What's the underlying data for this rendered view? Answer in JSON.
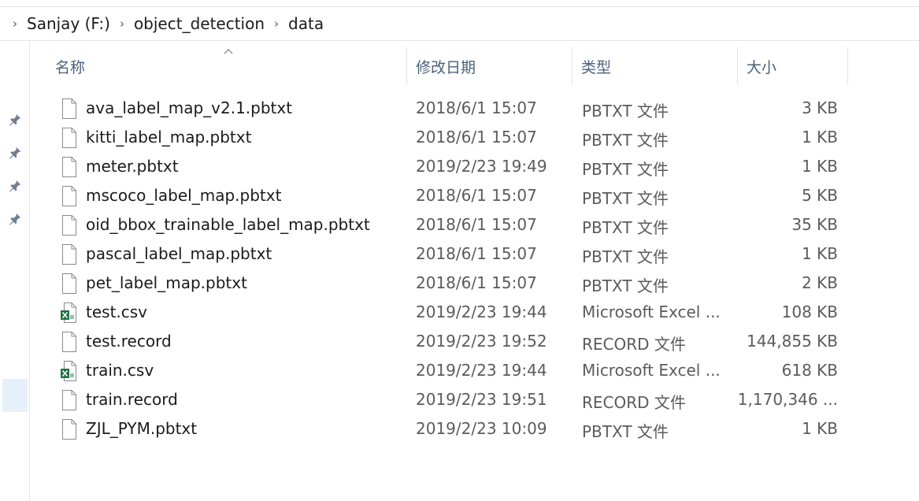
{
  "breadcrumb": {
    "items": [
      "Sanjay (F:)",
      "object_detection",
      "data"
    ]
  },
  "columns": {
    "name": "名称",
    "date": "修改日期",
    "type": "类型",
    "size": "大小"
  },
  "files": [
    {
      "name": "ava_label_map_v2.1.pbtxt",
      "date": "2018/6/1 15:07",
      "type": "PBTXT 文件",
      "size": "3 KB",
      "icon": "file-icon"
    },
    {
      "name": "kitti_label_map.pbtxt",
      "date": "2018/6/1 15:07",
      "type": "PBTXT 文件",
      "size": "1 KB",
      "icon": "file-icon"
    },
    {
      "name": "meter.pbtxt",
      "date": "2019/2/23 19:49",
      "type": "PBTXT 文件",
      "size": "1 KB",
      "icon": "file-icon"
    },
    {
      "name": "mscoco_label_map.pbtxt",
      "date": "2018/6/1 15:07",
      "type": "PBTXT 文件",
      "size": "5 KB",
      "icon": "file-icon"
    },
    {
      "name": "oid_bbox_trainable_label_map.pbtxt",
      "date": "2018/6/1 15:07",
      "type": "PBTXT 文件",
      "size": "35 KB",
      "icon": "file-icon"
    },
    {
      "name": "pascal_label_map.pbtxt",
      "date": "2018/6/1 15:07",
      "type": "PBTXT 文件",
      "size": "1 KB",
      "icon": "file-icon"
    },
    {
      "name": "pet_label_map.pbtxt",
      "date": "2018/6/1 15:07",
      "type": "PBTXT 文件",
      "size": "2 KB",
      "icon": "file-icon"
    },
    {
      "name": "test.csv",
      "date": "2019/2/23 19:44",
      "type": "Microsoft Excel ...",
      "size": "108 KB",
      "icon": "excel-file-icon"
    },
    {
      "name": "test.record",
      "date": "2019/2/23 19:52",
      "type": "RECORD 文件",
      "size": "144,855 KB",
      "icon": "file-icon"
    },
    {
      "name": "train.csv",
      "date": "2019/2/23 19:44",
      "type": "Microsoft Excel ...",
      "size": "618 KB",
      "icon": "excel-file-icon"
    },
    {
      "name": "train.record",
      "date": "2019/2/23 19:51",
      "type": "RECORD 文件",
      "size": "1,170,346 ...",
      "icon": "file-icon"
    },
    {
      "name": "ZJL_PYM.pbtxt",
      "date": "2019/2/23 10:09",
      "type": "PBTXT 文件",
      "size": "1 KB",
      "icon": "file-icon"
    }
  ],
  "nav_pane": {
    "pins": [
      "pin-icon",
      "pin-icon",
      "pin-icon",
      "pin-icon"
    ]
  },
  "colors": {
    "header_text": "#4c607a",
    "secondary_text": "#5b5b5b",
    "excel_green": "#1e7145",
    "selection_bg": "#e6f0fb"
  }
}
